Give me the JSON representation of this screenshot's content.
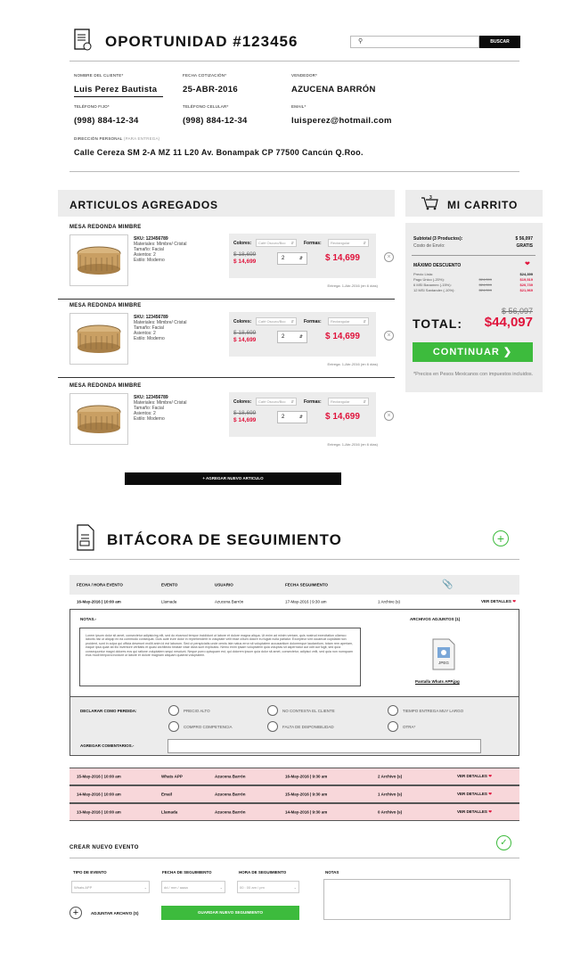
{
  "header": {
    "title": "OPORTUNIDAD #123456",
    "search_placeholder": "",
    "search_button": "BUSCAR"
  },
  "client": {
    "name_label": "NOMBRE DEL CLIENTE*",
    "name": "Luis Perez Bautista",
    "date_label": "FECHA COTIZACIÓN*",
    "date": "25-ABR-2016",
    "seller_label": "VENDEDOR*",
    "seller": "AZUCENA BARRÓN",
    "phone_label": "TELÉFONO FIJO*",
    "phone": "(998) 884-12-34",
    "cell_label": "TELÉFONO CELULAR*",
    "cell": "(998) 884-12-34",
    "email_label": "EMAIL*",
    "email": "luisperez@hotmail.com",
    "address_label": "DIRECCIÓN PERSONAL",
    "address_note": "(PARA ENTREGA)",
    "address": "Calle Cereza SM 2-A MZ 11 L20 Av. Bonampak CP 77500 Cancún Q.Roo."
  },
  "articles": {
    "title": "ARTICULOS AGREGADOS",
    "add_button": "+ AGREGAR NUEVO ARTICULO",
    "items": [
      {
        "name": "MESA REDONDA MIMBRE",
        "sku": "SKU: 123456789",
        "materials": "Materiales: Mimbre/ Cristal",
        "size": "Tamaño: Facial",
        "seats": "Asientos: 2",
        "style": "Estilo: Moderno",
        "colors_label": "Colores:",
        "colors_value": "Café Oscuro/Bco",
        "forms_label": "Formas:",
        "forms_value": "Rectangular",
        "old_price": "$ 18,699",
        "new_price": "$ 14,699",
        "qty": "2",
        "total": "$ 14,699",
        "delivery": "Entrega: 1-Abr-2016 (en 6 días)"
      },
      {
        "name": "MESA REDONDA MIMBRE",
        "sku": "SKU: 123456789",
        "materials": "Materiales: Mimbre/ Cristal",
        "size": "Tamaño: Facial",
        "seats": "Asientos: 2",
        "style": "Estilo: Moderno",
        "colors_label": "Colores:",
        "colors_value": "Café Oscuro/Bco",
        "forms_label": "Formas:",
        "forms_value": "Rectangular",
        "old_price": "$ 18,699",
        "new_price": "$ 14,699",
        "qty": "2",
        "total": "$ 14,699",
        "delivery": "Entrega: 1-Abr-2016 (en 6 días)"
      },
      {
        "name": "MESA REDONDA MIMBRE",
        "sku": "SKU: 123456789",
        "materials": "Materiales: Mimbre/ Cristal",
        "size": "Tamaño: Facial",
        "seats": "Asientos: 2",
        "style": "Estilo: Moderno",
        "colors_label": "Colores:",
        "colors_value": "Café Oscuro/Bco",
        "forms_label": "Formas:",
        "forms_value": "Rectangular",
        "old_price": "$ 18,699",
        "new_price": "$ 14,699",
        "qty": "2",
        "total": "$ 14,699",
        "delivery": "Entrega: 1-Abr-2016 (en 6 días)"
      }
    ]
  },
  "cart": {
    "title": "MI CARRITO",
    "cart_count": "3",
    "subtotal_label": "Subtotal (3 Productos):",
    "subtotal": "$ 56,097",
    "shipping_label": "Costo de Envío:",
    "shipping": "GRATIS",
    "discount_title": "MÁXIMO DESCUENTO",
    "discounts": [
      {
        "label": "Precio Lista:",
        "old": "",
        "value": "$24,399"
      },
      {
        "label": "Pago Único (-20%):",
        "old": "$24,399",
        "value": "$19,519"
      },
      {
        "label": "6 MSI Banamex (-15%):",
        "old": "$24,399",
        "value": "$20,739"
      },
      {
        "label": "12 MSI Santander (-10%):",
        "old": "$24,399",
        "value": "$21,969"
      }
    ],
    "old_total": "$ 56,097",
    "total_label": "TOTAL:",
    "total": "$44,097",
    "continue": "CONTINUAR",
    "note": "*Precios en Pesos Mexicanos con impuestos incluidos."
  },
  "log": {
    "title": "BITÁCORA DE SEGUIMIENTO",
    "headers": [
      "FECHA / HORA EVENTO",
      "EVENTO",
      "USUARIO",
      "FECHA SEGUIMIENTO"
    ],
    "first_row": {
      "date": "16-May-2016 | 10:00 am",
      "event": "Llamada",
      "user": "Azucena Barrón",
      "follow": "17-May-2016 | 9:30 am",
      "files": "1 Archivo (s)",
      "details": "VER DETALLES"
    },
    "notes_label": "NOTAS.-",
    "notes_text": "Lorem ipsum dolor sit amet, consectetur adipisicing elit, sed do eiusmod tempor incididunt ut labore et dolore magna aliqua. Ut enim ad minim veniam, quis nostrud exercitation ullamco laboris nisi ut aliquip ex ea commodo consequat. Duis aute irure dolor in reprehenderit in voluptate velit esse cillum dolore eu fugiat nulla pariatur. Excepteur sint occaecat cupidatat non proident, sunt in culpa qui officia deserunt mollit anim id est laborum. Sed ut perspiciatis unde omnis iste natus error sit voluptatem accusantium doloremque laudantium, totam rem aperiam, eaque ipsa quae ab illo inventore veritatis et quasi architecto beatae vitae dicta sunt explicabo. Nemo enim ipsam voluptatem quia voluptas sit aspernatur aut odit aut fugit, sed quia consequuntur magni dolores eos qui ratione voluptatem sequi nesciunt. Neque porro quisquam est, qui dolorem ipsum quia dolor sit amet, consectetur, adipisci velit, sed quia non numquam eius modi tempora incidunt ut labore et dolore magnam aliquam quaerat voluptatem.",
    "attachments_label": "ARCHIVOS ADJUNTOS (1)",
    "attachment_name": "Pantalla Whats APP.jpg",
    "attachment_type": "JPEG",
    "lost_label": "DECLARAR COMO PERDIDA:",
    "lost_options": [
      "PRECIO ALTO",
      "NO CONTESTA EL CLIENTE",
      "TIEMPO ENTREGA MUY LARGO",
      "COMPRO COMPETENCIA",
      "FALTA DE DISPONIBILIDAD",
      "OTRA*"
    ],
    "comments_label": "AGREGAR COMENTARIOS.-",
    "rows": [
      {
        "date": "15-May-2016 | 10:00 am",
        "event": "Whats APP",
        "user": "Azucena Barrón",
        "follow": "16-May-2016 | 9:30 am",
        "files": "2 Archivo (s)",
        "details": "VER DETALLES"
      },
      {
        "date": "14-May-2016 | 10:00 am",
        "event": "Email",
        "user": "Azucena Barrón",
        "follow": "15-May-2016 | 9:30 am",
        "files": "1 Archivo (s)",
        "details": "VER DETALLES"
      },
      {
        "date": "13-May-2016 | 10:00 am",
        "event": "Llamada",
        "user": "Azucena Barrón",
        "follow": "14-May-2016 | 9:30 am",
        "files": "0 Archivo (s)",
        "details": "VER DETALLES"
      }
    ]
  },
  "new_event": {
    "title": "CREAR NUEVO EVENTO",
    "type_label": "TIPO DE EVENTO",
    "type_value": "Whats APP",
    "date_label": "FECHA DE SEGUIMIENTO",
    "date_value": "dd / mm / aaaa",
    "time_label": "HORA DE SEGUIMIENTO",
    "time_value": "00 : 00  am / pm",
    "notes_label": "NOTAS",
    "attach_label": "ADJUNTAR ARCHIVO (S)",
    "save_button": "GUARDAR NUEVO SEGUIMIENTO"
  },
  "colors": {
    "accent_red": "#e0143c",
    "green": "#3dbb3d",
    "pink": "#f8d7da"
  }
}
